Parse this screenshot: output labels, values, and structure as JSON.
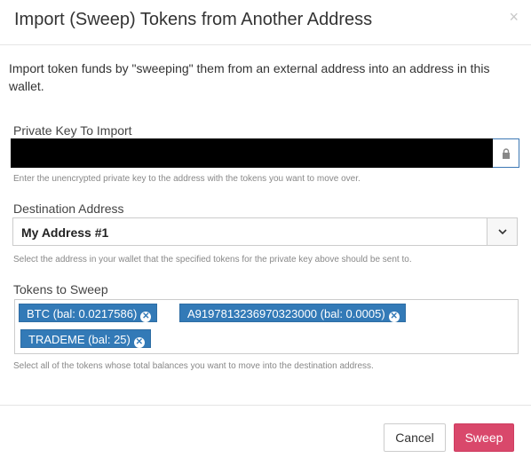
{
  "dialog": {
    "title": "Import (Sweep) Tokens from Another Address",
    "close_glyph": "×",
    "intro": "Import token funds by \"sweeping\" them from an external address into an address in this wallet."
  },
  "private_key": {
    "label": "Private Key To Import",
    "help": "Enter the unencrypted private key to the address with the tokens you want to move over.",
    "icon": "lock-icon"
  },
  "destination": {
    "label": "Destination Address",
    "selected": "My Address #1",
    "help": "Select the address in your wallet that the specified tokens for the private key above should be sent to.",
    "icon": "chevron-down-icon"
  },
  "tokens": {
    "label": "Tokens to Sweep",
    "items": [
      {
        "label": "BTC (bal: 0.0217586)"
      },
      {
        "label": "A9197813236970323000 (bal: 0.0005)"
      },
      {
        "label": "TRADEME (bal: 25)"
      }
    ],
    "remove_glyph": "✕",
    "help": "Select all of the tokens whose total balances you want to move into the destination address."
  },
  "footer": {
    "cancel_label": "Cancel",
    "sweep_label": "Sweep"
  },
  "colors": {
    "token_bg": "#337ab7",
    "sweep_bg": "#d9486b",
    "focus_border": "#3c78b5"
  }
}
